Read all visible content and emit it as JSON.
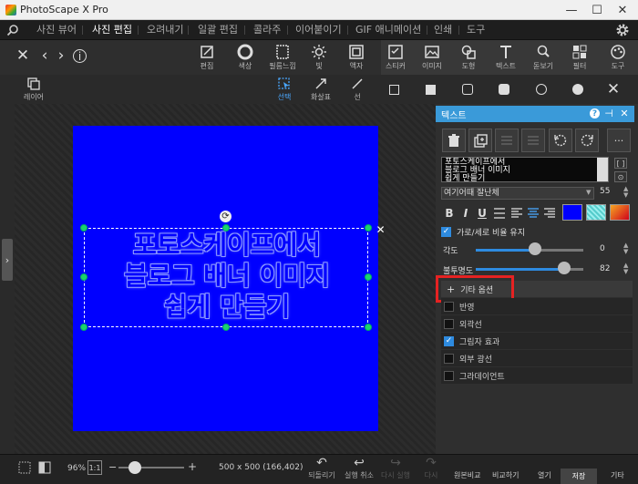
{
  "app": {
    "title": "PhotoScape X Pro"
  },
  "window": {
    "minimize": "—",
    "maximize": "☐",
    "close": "✕"
  },
  "menu": {
    "tabs": [
      "사진 뷰어",
      "사진 편집",
      "오려내기",
      "일괄 편집",
      "콜라주",
      "이어붙이기",
      "GIF 애니메이션",
      "인쇄",
      "도구"
    ],
    "active_tab": "사진 편집"
  },
  "toolbar": {
    "tools": [
      "편집",
      "색상",
      "필름느낌",
      "빛",
      "액자",
      "스티커",
      "이미지",
      "도형",
      "텍스트",
      "돋보기",
      "필터",
      "도구"
    ]
  },
  "subtoolbar": {
    "layer": "레이어",
    "select": "선택",
    "arrow": "화살표",
    "line": "선"
  },
  "canvas": {
    "background_color": "#0000ff",
    "text": "포토스케이프에서\n블로그 배너 이미지\n쉽게 만들기"
  },
  "panel": {
    "title": "텍스트",
    "text_value": "포토스케이프에서\n블로그 배너 이미지\n쉽게 만들기",
    "text_box_buttons": [
      "[ ]",
      "⊙"
    ],
    "font": "여기어때 잘난체",
    "font_size": "55",
    "format": {
      "bold": "B",
      "italic": "I",
      "underline": "U"
    },
    "keep_ratio_label": "가로/세로 비율 유지",
    "angle": {
      "label": "각도",
      "value": "0",
      "fraction": 0.55
    },
    "opacity": {
      "label": "불투명도",
      "value": "82",
      "fraction": 0.82
    },
    "more_options": "기타 옵션",
    "options": [
      {
        "label": "반영",
        "checked": false
      },
      {
        "label": "외곽선",
        "checked": false
      },
      {
        "label": "그림자 효과",
        "checked": true
      },
      {
        "label": "외부 광선",
        "checked": false
      },
      {
        "label": "그라데이언트",
        "checked": false
      }
    ],
    "text_color": "#0000ff",
    "accent": "#3a9ad9",
    "highlight": "#e52222"
  },
  "status": {
    "zoom": "96%",
    "one_to_one": "1:1",
    "minus": "−",
    "plus": "+",
    "image_info": "500 x 500 (166,402)",
    "zoom_fraction": 0.25
  },
  "history": {
    "revert": "되돌리기",
    "undo": "실행 취소",
    "redo_all": "다시 실행",
    "redo": "다시"
  },
  "bottom": {
    "compare_original": "원본비교",
    "compare": "비교하기",
    "open": "열기",
    "save": "저장",
    "other": "기타"
  }
}
